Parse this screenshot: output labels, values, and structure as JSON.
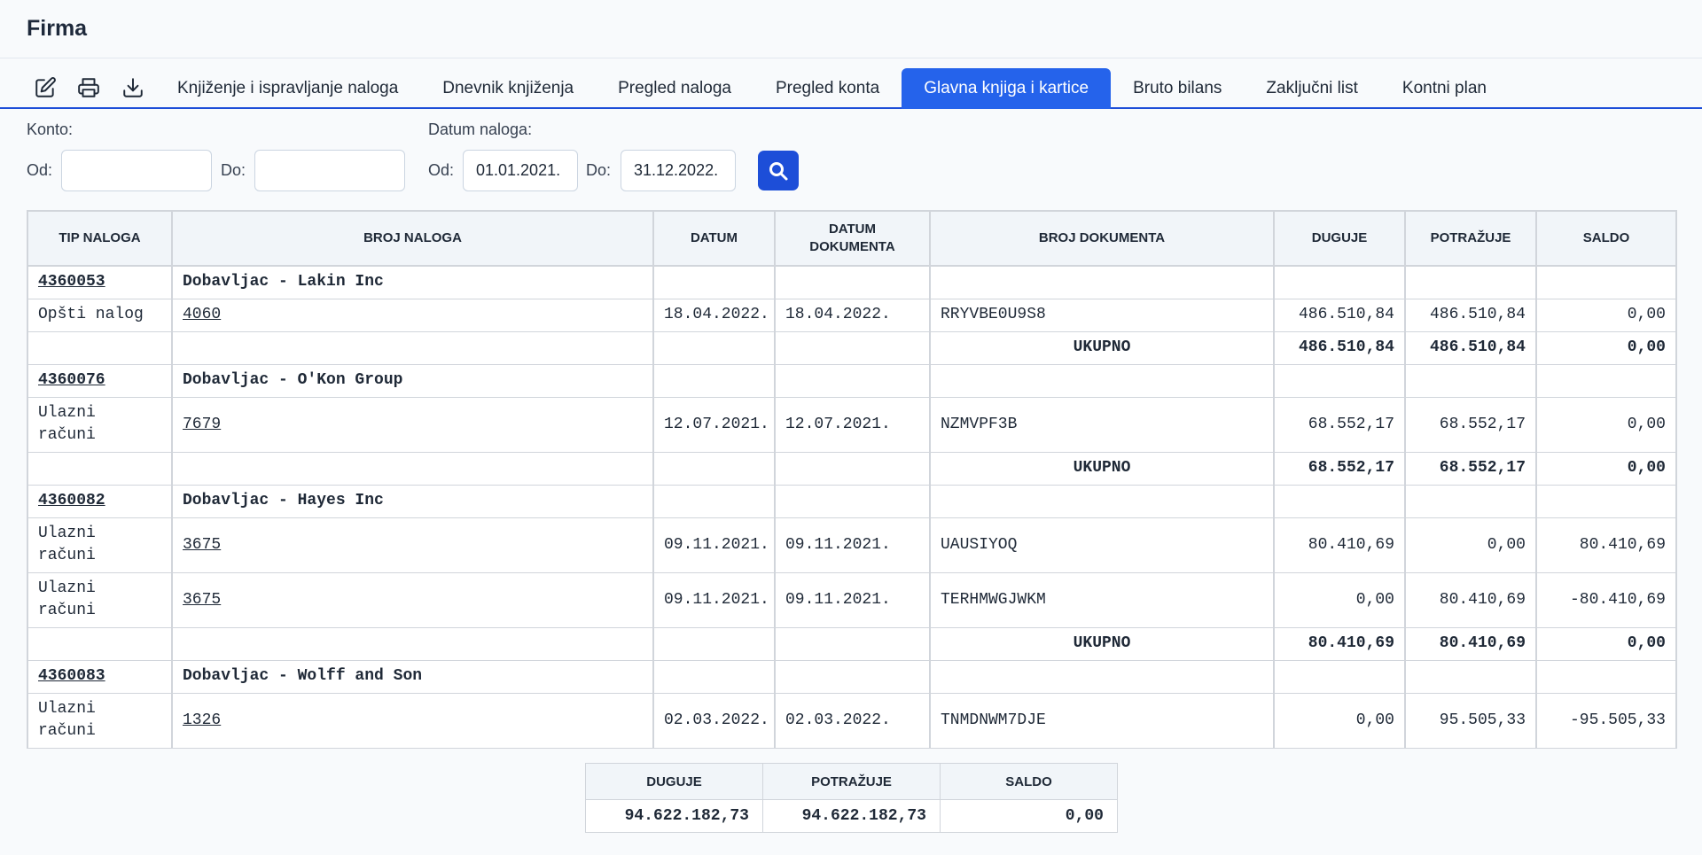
{
  "app": {
    "title": "Firma"
  },
  "toolbar": {
    "icons": [
      "edit-icon",
      "print-icon",
      "download-icon"
    ],
    "tabs": [
      {
        "label": "Knjiženje i ispravljanje naloga",
        "active": false
      },
      {
        "label": "Dnevnik knjiženja",
        "active": false
      },
      {
        "label": "Pregled naloga",
        "active": false
      },
      {
        "label": "Pregled konta",
        "active": false
      },
      {
        "label": "Glavna knjiga i kartice",
        "active": true
      },
      {
        "label": "Bruto bilans",
        "active": false
      },
      {
        "label": "Zaključni list",
        "active": false
      },
      {
        "label": "Kontni plan",
        "active": false
      }
    ]
  },
  "filters": {
    "konto_label": "Konto:",
    "datum_label": "Datum naloga:",
    "od_label": "Od:",
    "do_label": "Do:",
    "konto_od": "",
    "konto_do": "",
    "datum_od": "01.01.2021.",
    "datum_do": "31.12.2022."
  },
  "table": {
    "headers": {
      "tip": "TIP NALOGA",
      "broj": "BROJ NALOGA",
      "datum": "DATUM",
      "datum_dok_1": "DATUM",
      "datum_dok_2": "DOKUMENTA",
      "broj_dok": "BROJ DOKUMENTA",
      "duguje": "DUGUJE",
      "potrazuje": "POTRAŽUJE",
      "saldo": "SALDO"
    },
    "groups": [
      {
        "konto": "4360053",
        "name": "Dobavljac - Lakin Inc",
        "rows": [
          {
            "tip": "Opšti nalog",
            "broj": "4060",
            "datum": "18.04.2022.",
            "datum_dok": "18.04.2022.",
            "broj_dok": "RRYVBE0U9S8",
            "duguje": "486.510,84",
            "potrazuje": "486.510,84",
            "saldo": "0,00"
          }
        ],
        "total": {
          "label": "UKUPNO",
          "duguje": "486.510,84",
          "potrazuje": "486.510,84",
          "saldo": "0,00"
        }
      },
      {
        "konto": "4360076",
        "name": "Dobavljac - O'Kon Group",
        "rows": [
          {
            "tip": "Ulazni računi",
            "broj": "7679",
            "datum": "12.07.2021.",
            "datum_dok": "12.07.2021.",
            "broj_dok": "NZMVPF3B",
            "duguje": "68.552,17",
            "potrazuje": "68.552,17",
            "saldo": "0,00"
          }
        ],
        "total": {
          "label": "UKUPNO",
          "duguje": "68.552,17",
          "potrazuje": "68.552,17",
          "saldo": "0,00"
        }
      },
      {
        "konto": "4360082",
        "name": "Dobavljac - Hayes Inc",
        "rows": [
          {
            "tip": "Ulazni računi",
            "broj": "3675",
            "datum": "09.11.2021.",
            "datum_dok": "09.11.2021.",
            "broj_dok": "UAUSIYOQ",
            "duguje": "80.410,69",
            "potrazuje": "0,00",
            "saldo": "80.410,69"
          },
          {
            "tip": "Ulazni računi",
            "broj": "3675",
            "datum": "09.11.2021.",
            "datum_dok": "09.11.2021.",
            "broj_dok": "TERHMWGJWKM",
            "duguje": "0,00",
            "potrazuje": "80.410,69",
            "saldo": "-80.410,69"
          }
        ],
        "total": {
          "label": "UKUPNO",
          "duguje": "80.410,69",
          "potrazuje": "80.410,69",
          "saldo": "0,00"
        }
      },
      {
        "konto": "4360083",
        "name": "Dobavljac - Wolff and Son",
        "rows": [
          {
            "tip": "Ulazni računi",
            "broj": "1326",
            "datum": "02.03.2022.",
            "datum_dok": "02.03.2022.",
            "broj_dok": "TNMDNWM7DJE",
            "duguje": "0,00",
            "potrazuje": "95.505,33",
            "saldo": "-95.505,33"
          }
        ]
      }
    ]
  },
  "summary": {
    "headers": {
      "duguje": "DUGUJE",
      "potrazuje": "POTRAŽUJE",
      "saldo": "SALDO"
    },
    "duguje": "94.622.182,73",
    "potrazuje": "94.622.182,73",
    "saldo": "0,00"
  },
  "colors": {
    "accent": "#2563eb",
    "search_button": "#1d4ed8"
  }
}
